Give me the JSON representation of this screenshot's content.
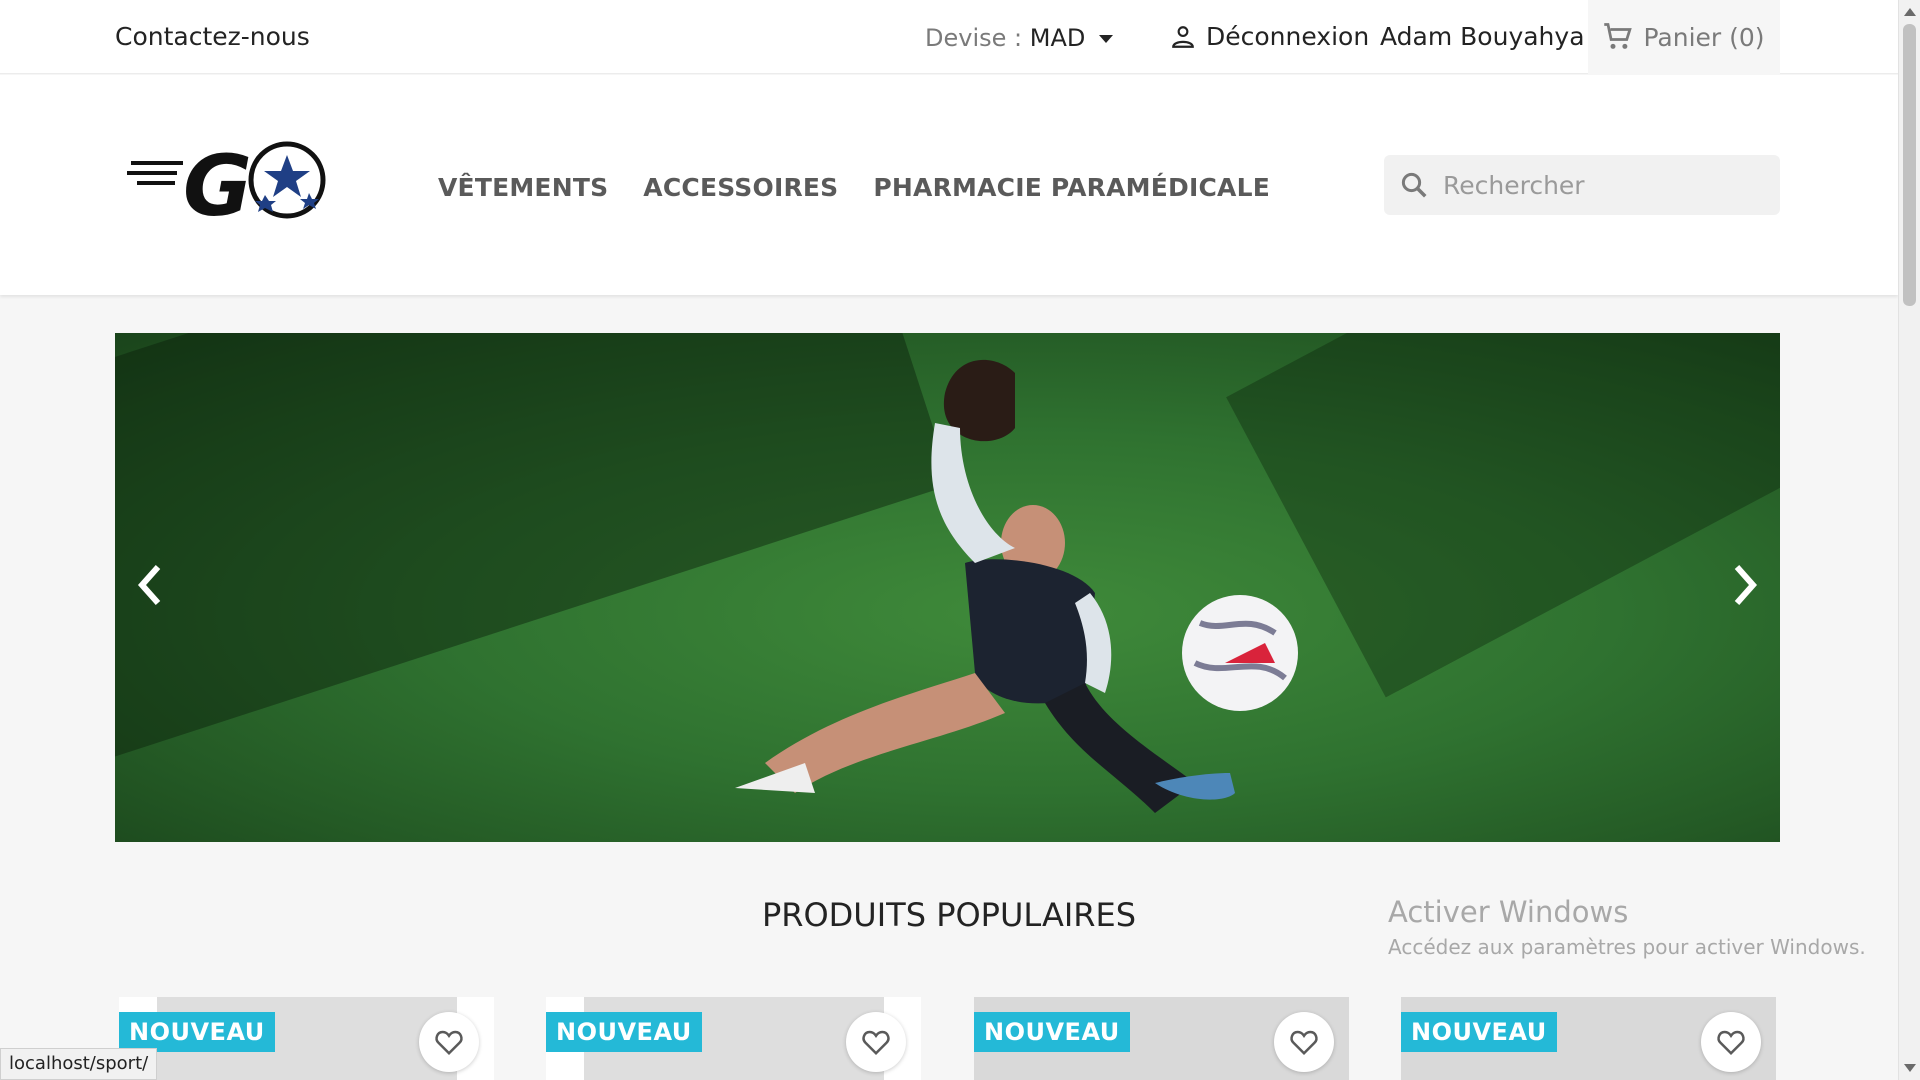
{
  "topbar": {
    "contact_label": "Contactez-nous",
    "currency_label": "Devise :",
    "currency_value": "MAD",
    "logout_label": "Déconnexion",
    "user_name": "Adam Bouyahya",
    "cart_label": "Panier (0)"
  },
  "header": {
    "logo_text": "GO",
    "nav": [
      "VÊTEMENTS",
      "ACCESSOIRES",
      "PHARMACIE PARAMÉDICALE"
    ],
    "search_placeholder": "Rechercher"
  },
  "slider": {
    "prev_icon": "chevron-left-icon",
    "next_icon": "chevron-right-icon"
  },
  "section": {
    "title": "PRODUITS POPULAIRES"
  },
  "products": [
    {
      "badge": "NOUVEAU"
    },
    {
      "badge": "NOUVEAU"
    },
    {
      "badge": "NOUVEAU"
    },
    {
      "badge": "NOUVEAU"
    }
  ],
  "watermark": {
    "title": "Activer Windows",
    "subtitle": "Accédez aux paramètres pour activer Windows."
  },
  "status_url": "localhost/sport/",
  "colors": {
    "badge_bg": "#24b9d7",
    "grass": "#2f7230"
  }
}
